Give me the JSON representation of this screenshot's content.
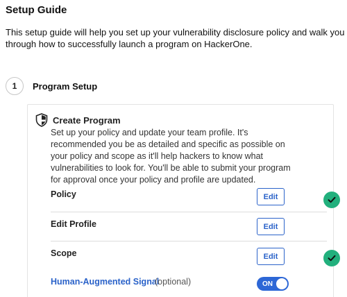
{
  "page": {
    "title": "Setup Guide",
    "intro": "This setup guide will help you set up your vulnerability disclosure policy and walk you through how to successfully launch a program on HackerOne."
  },
  "step": {
    "number": "1",
    "title": "Program Setup"
  },
  "card": {
    "icon": "shield-icon",
    "title": "Create Program",
    "description": "Set up your policy and update your team profile. It's recommended you be as detailed and specific as possible on your policy and scope as it'll help hackers to know what vulnerabilities to look for. You'll be able to submit your program for approval once your policy and profile are updated.",
    "items": [
      {
        "label": "Policy",
        "button": "Edit",
        "completed": true
      },
      {
        "label": "Edit Profile",
        "button": "Edit",
        "completed": false
      },
      {
        "label": "Scope",
        "button": "Edit",
        "completed": true
      }
    ],
    "signal": {
      "label": "Human-Augmented Signal",
      "note": "(optional)",
      "toggle": "ON"
    }
  },
  "colors": {
    "accent": "#2a62c9",
    "success": "#22b07d",
    "toggle_on": "#2d67d6"
  }
}
